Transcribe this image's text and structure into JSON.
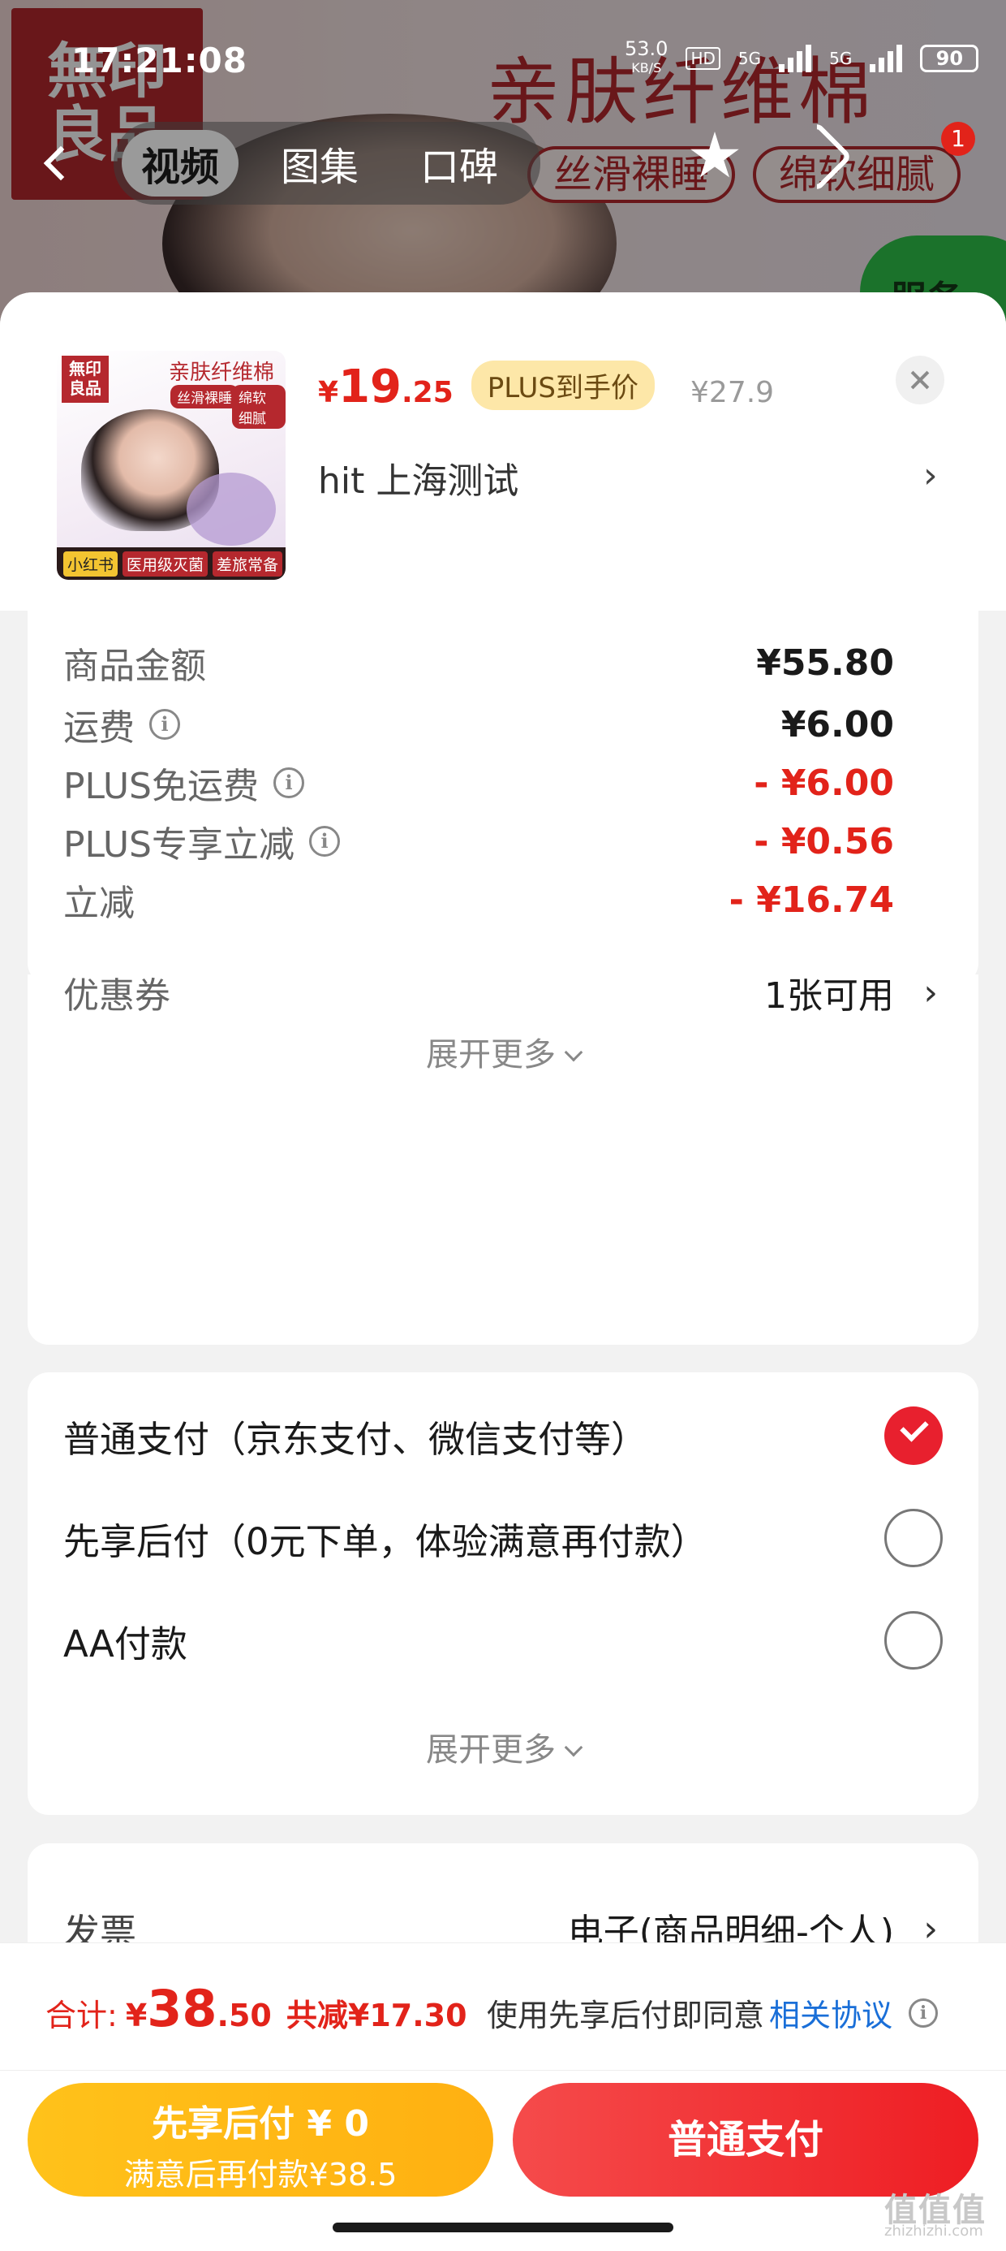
{
  "status": {
    "time": "17:21:08",
    "net_speed": "53.0",
    "net_unit": "KB/S",
    "hd": "HD",
    "gen1": "5G",
    "gen2": "5G",
    "battery": "90"
  },
  "background": {
    "logo_line1": "無印",
    "logo_line2": "良品",
    "headline": "亲肤纤维棉",
    "pill1": "丝滑裸睡",
    "pill2": "绵软细腻",
    "green_text": "服务",
    "cart_count": "1"
  },
  "nav": {
    "tabs": [
      "视频",
      "图集",
      "口碑"
    ]
  },
  "product": {
    "thumb_logo1": "無印",
    "thumb_logo2": "良品",
    "thumb_headline": "亲肤纤维棉",
    "thumb_pill1": "丝滑裸睡",
    "thumb_pill2": "绵软细腻",
    "thumb_tags": [
      "小红书",
      "医用级灭菌",
      "差旅常备"
    ],
    "price_symbol": "¥",
    "price_int": "19",
    "price_dec": ".25",
    "plus_badge": "PLUS到手价",
    "original_price": "¥27.9",
    "address": "hit  上海测试"
  },
  "fees": {
    "rows": [
      {
        "label": "商品金额",
        "value": "¥55.80"
      },
      {
        "label": "运费",
        "value": "¥6.00"
      },
      {
        "label": "PLUS免运费",
        "value": "- ¥6.00"
      },
      {
        "label": "PLUS专享立减",
        "value": "- ¥0.56"
      },
      {
        "label": "立减",
        "value": "- ¥16.74"
      },
      {
        "label": "优惠券",
        "value": "1张可用"
      }
    ],
    "expand_more": "展开更多"
  },
  "payment": {
    "options": [
      {
        "label": "普通支付（京东支付、微信支付等）",
        "selected": true
      },
      {
        "label": "先享后付（0元下单，体验满意再付款）",
        "selected": false
      },
      {
        "label": "AA付款",
        "selected": false
      }
    ],
    "expand_more": "展开更多"
  },
  "invoice": {
    "label": "发票",
    "value": "电子(商品明细-个人)"
  },
  "footer": {
    "total_label": "合计:",
    "total_symbol": "¥",
    "total_int": "38",
    "total_dec": ".50",
    "total_saving": "共减¥17.30",
    "agree_text": "使用先享后付即同意",
    "agree_link": "相关协议",
    "btn_later_line1": "先享后付 ¥ 0",
    "btn_later_line2": "满意后再付款¥38.5",
    "btn_normal": "普通支付",
    "watermark": "值值值",
    "watermark_sub": "zhizhizhi.com"
  },
  "colors": {
    "accent_red": "#e2231a",
    "plus_gold": "#fde7a8",
    "later_yellow": "#ffb811",
    "link_blue": "#1a6fd8"
  },
  "icons": [
    "back-chevron-icon",
    "star-icon",
    "share-icon",
    "close-icon",
    "info-icon",
    "chevron-right-icon",
    "check-icon"
  ]
}
